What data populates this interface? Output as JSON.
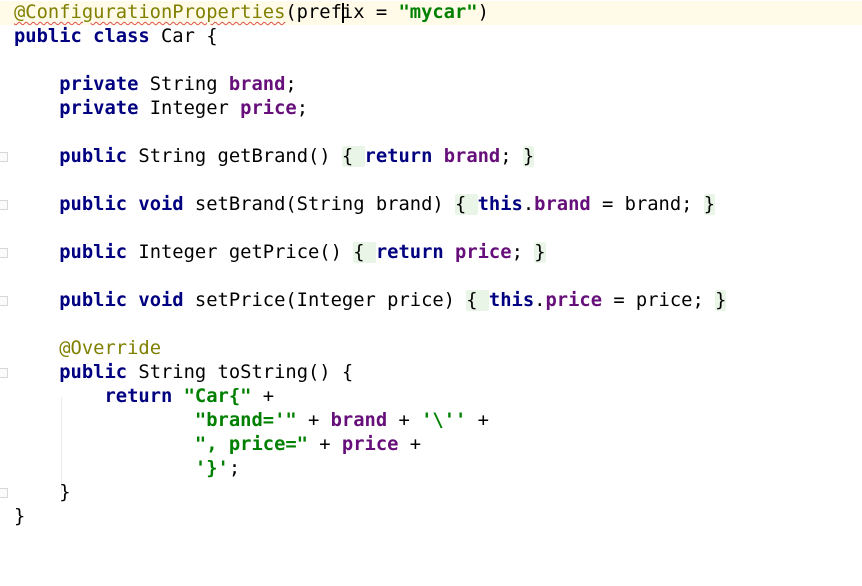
{
  "editor": {
    "language": "java",
    "lines": [
      [
        {
          "t": "@ConfigurationProperties",
          "c": "ann-err"
        },
        {
          "t": "(prefix = ",
          "c": ""
        },
        {
          "t": "\"mycar\"",
          "c": "str"
        },
        {
          "t": ")",
          "c": ""
        }
      ],
      [
        {
          "t": "public class ",
          "c": "kw"
        },
        {
          "t": "Car {",
          "c": ""
        }
      ],
      [],
      [
        {
          "t": "    ",
          "c": ""
        },
        {
          "t": "private ",
          "c": "kw"
        },
        {
          "t": "String ",
          "c": ""
        },
        {
          "t": "brand",
          "c": "fld"
        },
        {
          "t": ";",
          "c": ""
        }
      ],
      [
        {
          "t": "    ",
          "c": ""
        },
        {
          "t": "private ",
          "c": "kw"
        },
        {
          "t": "Integer ",
          "c": ""
        },
        {
          "t": "price",
          "c": "fld"
        },
        {
          "t": ";",
          "c": ""
        }
      ],
      [],
      [
        {
          "t": "    ",
          "c": ""
        },
        {
          "t": "public ",
          "c": "kw"
        },
        {
          "t": "String getBrand() ",
          "c": ""
        },
        {
          "t": "{ ",
          "c": "brace-fold"
        },
        {
          "t": "return ",
          "c": "kw"
        },
        {
          "t": "brand",
          "c": "fld"
        },
        {
          "t": "; ",
          "c": ""
        },
        {
          "t": "}",
          "c": "brace-fold"
        }
      ],
      [],
      [
        {
          "t": "    ",
          "c": ""
        },
        {
          "t": "public void ",
          "c": "kw"
        },
        {
          "t": "setBrand(String brand) ",
          "c": ""
        },
        {
          "t": "{ ",
          "c": "brace-fold"
        },
        {
          "t": "this",
          "c": "kw"
        },
        {
          "t": ".",
          "c": ""
        },
        {
          "t": "brand",
          "c": "fld"
        },
        {
          "t": " = brand; ",
          "c": ""
        },
        {
          "t": "}",
          "c": "brace-fold"
        }
      ],
      [],
      [
        {
          "t": "    ",
          "c": ""
        },
        {
          "t": "public ",
          "c": "kw"
        },
        {
          "t": "Integer getPrice() ",
          "c": ""
        },
        {
          "t": "{ ",
          "c": "brace-fold"
        },
        {
          "t": "return ",
          "c": "kw"
        },
        {
          "t": "price",
          "c": "fld"
        },
        {
          "t": "; ",
          "c": ""
        },
        {
          "t": "}",
          "c": "brace-fold"
        }
      ],
      [],
      [
        {
          "t": "    ",
          "c": ""
        },
        {
          "t": "public void ",
          "c": "kw"
        },
        {
          "t": "setPrice(Integer price) ",
          "c": ""
        },
        {
          "t": "{ ",
          "c": "brace-fold"
        },
        {
          "t": "this",
          "c": "kw"
        },
        {
          "t": ".",
          "c": ""
        },
        {
          "t": "price",
          "c": "fld"
        },
        {
          "t": " = price; ",
          "c": ""
        },
        {
          "t": "}",
          "c": "brace-fold"
        }
      ],
      [],
      [
        {
          "t": "    ",
          "c": ""
        },
        {
          "t": "@Override",
          "c": "ann"
        }
      ],
      [
        {
          "t": "    ",
          "c": ""
        },
        {
          "t": "public ",
          "c": "kw"
        },
        {
          "t": "String toString() {",
          "c": ""
        }
      ],
      [
        {
          "t": "        ",
          "c": ""
        },
        {
          "t": "return ",
          "c": "kw"
        },
        {
          "t": "\"Car{\"",
          "c": "str"
        },
        {
          "t": " +",
          "c": ""
        }
      ],
      [
        {
          "t": "                ",
          "c": ""
        },
        {
          "t": "\"brand='\"",
          "c": "str"
        },
        {
          "t": " + ",
          "c": ""
        },
        {
          "t": "brand",
          "c": "fld"
        },
        {
          "t": " + ",
          "c": ""
        },
        {
          "t": "'\\''",
          "c": "str"
        },
        {
          "t": " +",
          "c": ""
        }
      ],
      [
        {
          "t": "                ",
          "c": ""
        },
        {
          "t": "\", price=\"",
          "c": "str"
        },
        {
          "t": " + ",
          "c": ""
        },
        {
          "t": "price",
          "c": "fld"
        },
        {
          "t": " +",
          "c": ""
        }
      ],
      [
        {
          "t": "                ",
          "c": ""
        },
        {
          "t": "'}'",
          "c": "str"
        },
        {
          "t": ";",
          "c": ""
        }
      ],
      [
        {
          "t": "    }",
          "c": ""
        }
      ],
      [
        {
          "t": "}",
          "c": ""
        }
      ]
    ]
  }
}
